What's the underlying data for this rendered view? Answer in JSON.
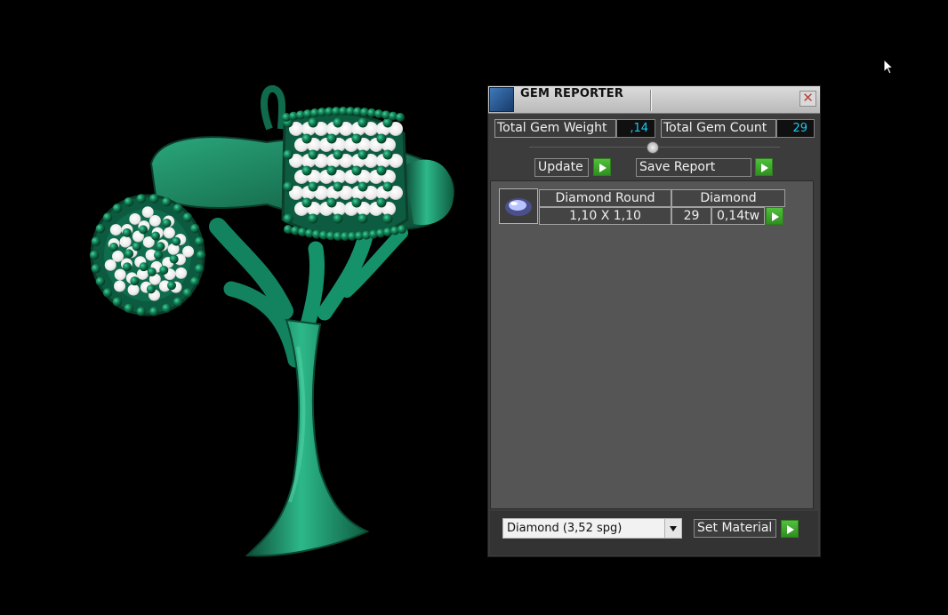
{
  "window": {
    "title": "GEM REPORTER",
    "close_label": "✕"
  },
  "summary": {
    "total_gem_weight_label": "Total Gem Weight",
    "total_gem_weight_value": ",14",
    "total_gem_count_label": "Total Gem Count",
    "total_gem_count_value": "29"
  },
  "actions": {
    "update_label": "Update",
    "save_report_label": "Save Report",
    "set_material_label": "Set Material"
  },
  "gem_list": {
    "items": [
      {
        "shape": "Diamond Round",
        "material": "Diamond",
        "size": "1,10 X 1,10",
        "count": "29",
        "weight": "0,14tw"
      }
    ]
  },
  "material_selector": {
    "selected": "Diamond    (3,52 spg)"
  },
  "colors": {
    "accent_cyan": "#17c8f0",
    "accent_green": "#4cbc38",
    "jewelry_green": "#1d8f6a"
  },
  "icons": {
    "app": "gem-reporter-icon",
    "close": "close-icon",
    "arrow": "play-arrow-icon",
    "gem": "round-diamond-icon",
    "cursor": "mouse-cursor-icon",
    "dropdown": "chevron-down-icon"
  }
}
